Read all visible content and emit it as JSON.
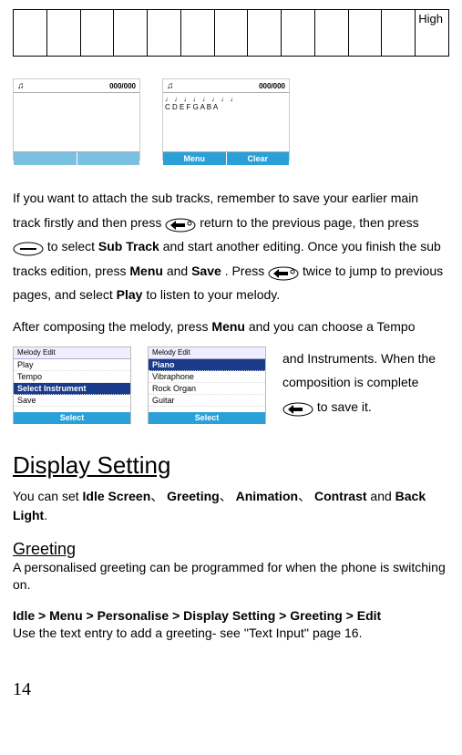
{
  "table": {
    "last_cell": "High"
  },
  "shot1": {
    "counter": "000/000"
  },
  "shot2": {
    "counter": "000/000",
    "notes_line1": "♩ ♩ ♩ ♩ ♩ ♩ ♩ ♩",
    "notes_line2": "C D E F G A B A",
    "soft_left": "Menu",
    "soft_right": "Clear"
  },
  "p1": {
    "t1": "If you want to attach the sub tracks, remember to save your earlier main track firstly and then press ",
    "t2": "  return to the previous page, then press ",
    "t3": " to select ",
    "bold1": "Sub Track",
    "t4": " and start another editing. Once you finish the sub tracks edition, press ",
    "bold2": "Menu",
    "t5": " and ",
    "bold3": "Save",
    "t6": ". Press ",
    "t7": "   twice to jump to previous pages, and select ",
    "bold4": "Play",
    "t8": " to listen to your melody."
  },
  "p2": {
    "t1": "After composing the melody, press ",
    "bold1": "Menu",
    "t2": " and you can choose a Tempo"
  },
  "melody1": {
    "title": "Melody Edit",
    "items": [
      "Play",
      "Tempo",
      "Select Instrument",
      "Save"
    ],
    "sel_index": 2,
    "soft": "Select"
  },
  "melody2": {
    "title": "Melody Edit",
    "items": [
      "Piano",
      "Vibraphone",
      "Rock Organ",
      "Guitar"
    ],
    "sel_index": 0,
    "soft": "Select"
  },
  "p3": {
    "t1": "and Instruments. When the composition is complete ",
    "t2": " to save it."
  },
  "h1": "Display Setting",
  "p4": {
    "t1": "You can set ",
    "b1": "Idle Screen",
    "c1": "、 ",
    "b2": "Greeting",
    "c2": "、",
    "b3": "Animation",
    "c3": "、",
    "b4": "Contrast",
    "t2": " and ",
    "b5": "Back Light",
    "t3": "."
  },
  "h2": "Greeting",
  "p5": "A personalised greeting can be programmed for when the phone is switching on.",
  "p6b": "Idle > Menu > Personalise > Display Setting > Greeting > Edit",
  "p6": "Use the text entry to add a greeting- see ''Text Input'' page 16.",
  "page": "14"
}
